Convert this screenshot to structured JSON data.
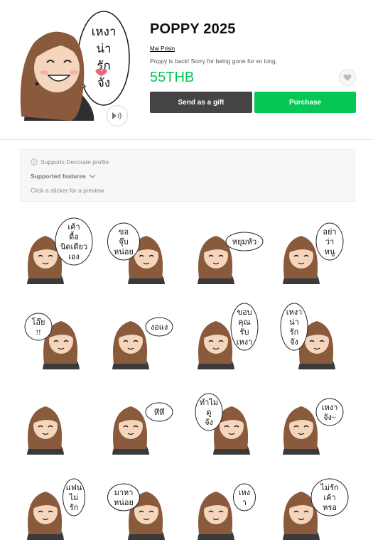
{
  "header": {
    "title": "POPPY 2025",
    "author": "Mai Prisin",
    "description": "Poppy is back! Sorry for being gone for so long.",
    "price": "55THB",
    "send_gift_label": "Send as a gift",
    "purchase_label": "Purchase",
    "hero_bubble": [
      "เหงา",
      "น่า",
      "รัก",
      "จัง"
    ]
  },
  "info": {
    "decorate": "Supports Decorate profile",
    "features_label": "Supported features",
    "hint": "Click a sticker for a preview."
  },
  "stickers": [
    {
      "text": [
        "เค้า",
        "ดื้อ",
        "นิดเดียว",
        "เอง"
      ]
    },
    {
      "text": [
        "ขอ",
        "จุ๊บ",
        "หน่อย"
      ]
    },
    {
      "text": [
        "หยุมหัว"
      ]
    },
    {
      "text": [
        "อย่า",
        "ว่า",
        "หนู"
      ]
    },
    {
      "text": [
        "โอ๊ย",
        "!!"
      ]
    },
    {
      "text": [
        "งอแง"
      ]
    },
    {
      "text": [
        "ขอบ",
        "คุณ",
        "รับ",
        "เหงา"
      ]
    },
    {
      "text": [
        "เหงา",
        "น่า",
        "รัก",
        "จัง"
      ]
    },
    {
      "text": []
    },
    {
      "text": [
        "หึหึ"
      ]
    },
    {
      "text": [
        "ทำไม",
        "ดู",
        "จัง"
      ]
    },
    {
      "text": [
        "เหงา",
        "จัง~"
      ]
    },
    {
      "text": [
        "แฟน",
        "ไม่",
        "รัก"
      ]
    },
    {
      "text": [
        "มาหา",
        "หน่อย"
      ]
    },
    {
      "text": [
        "เหง",
        "า"
      ]
    },
    {
      "text": [
        "ไม่รัก",
        "เค้า",
        "หรอ"
      ]
    }
  ],
  "colors": {
    "accent": "#06c755",
    "gift_button": "#444444",
    "hair": "#8a5a3c",
    "skin": "#f5d6bd",
    "shirt": "#3a3a3a"
  }
}
